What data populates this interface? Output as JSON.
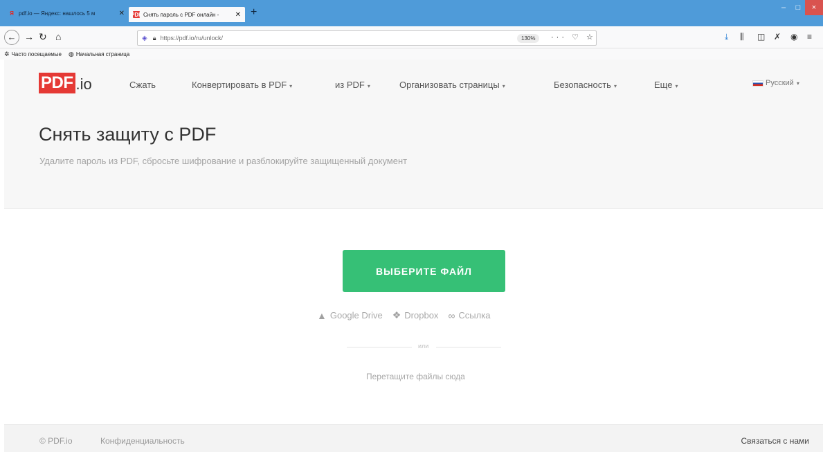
{
  "browser": {
    "tabs": [
      {
        "title": "pdf.io — Яндекс: нашлось 5 м",
        "favicon": "yandex-icon"
      },
      {
        "title": "Снять пароль с PDF онлайн -",
        "favicon": "pdfio-favicon"
      }
    ],
    "new_tab": "+",
    "url": "https://pdf.io/ru/unlock/",
    "zoom": "130%",
    "bookmarks": [
      "Часто посещаемые",
      "Начальная страница"
    ],
    "window_controls": {
      "minimize": "–",
      "maximize": "□",
      "close": "×"
    }
  },
  "site": {
    "logo_mark": "PDF",
    "logo_tail": ".io",
    "nav": [
      {
        "label": "Сжать",
        "has_caret": false
      },
      {
        "label": "Конвертировать в PDF",
        "has_caret": true
      },
      {
        "label": "из PDF",
        "has_caret": true
      },
      {
        "label": "Организовать страницы",
        "has_caret": true
      },
      {
        "label": "Безопасность",
        "has_caret": true
      },
      {
        "label": "Еще",
        "has_caret": true
      }
    ],
    "caret": "▾",
    "language": "Русский"
  },
  "page": {
    "title": "Снять защиту с PDF",
    "subtitle": "Удалите пароль из PDF, сбросьте шифрование и разблокируйте защищенный документ"
  },
  "upload": {
    "button_label": "ВЫБЕРИТЕ ФАЙЛ",
    "sources": [
      {
        "label": "Google Drive",
        "icon": "google-drive-icon"
      },
      {
        "label": "Dropbox",
        "icon": "dropbox-icon"
      },
      {
        "label": "Ссылка",
        "icon": "link-icon"
      }
    ],
    "or_text": "или",
    "drop_hint": "Перетащите файлы сюда"
  },
  "footer": {
    "copyright": "© PDF.io",
    "privacy": "Конфиденциальность",
    "contact": "Связаться с нами"
  },
  "colors": {
    "brand_red": "#e53935",
    "button_green": "#36c076",
    "browser_blue": "#4f9bd9"
  }
}
